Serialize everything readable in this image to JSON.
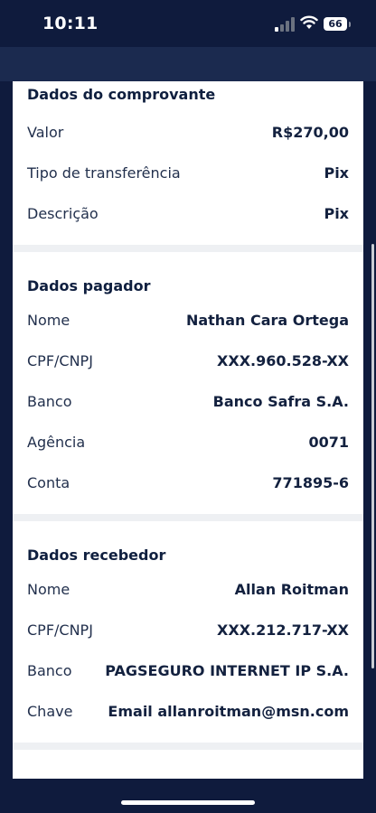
{
  "status": {
    "time": "10:11",
    "battery": "66"
  },
  "payer_section_title": "Dados do comprovante",
  "receipt": {
    "title": "Dados do comprovante",
    "rows": [
      {
        "label": "Valor",
        "value": "R$270,00"
      },
      {
        "label": "Tipo de transferência",
        "value": "Pix"
      },
      {
        "label": "Descrição",
        "value": "Pix"
      }
    ]
  },
  "payer": {
    "title": "Dados pagador",
    "rows": [
      {
        "label": "Nome",
        "value": "Nathan Cara Ortega"
      },
      {
        "label": "CPF/CNPJ",
        "value": "XXX.960.528-XX"
      },
      {
        "label": "Banco",
        "value": "Banco Safra S.A."
      },
      {
        "label": "Agência",
        "value": "0071"
      },
      {
        "label": "Conta",
        "value": "771895-6"
      }
    ]
  },
  "receiver": {
    "title": "Dados recebedor",
    "rows": [
      {
        "label": "Nome",
        "value": "Allan Roitman"
      },
      {
        "label": "CPF/CNPJ",
        "value": "XXX.212.717-XX"
      },
      {
        "label": "Banco",
        "value": "PAGSEGURO INTERNET IP S.A."
      },
      {
        "label": "Chave",
        "value": "Email allanroitman@msn.com"
      }
    ]
  }
}
